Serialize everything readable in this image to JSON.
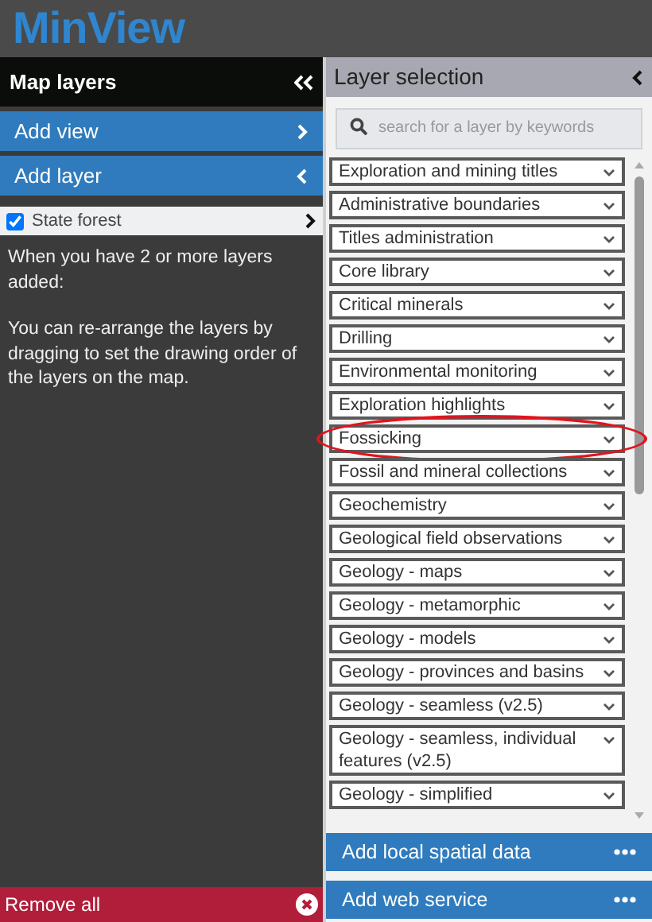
{
  "logo": "MinView",
  "map_layers": {
    "title": "Map layers",
    "actions": [
      {
        "label": "Add view",
        "expanded": false
      },
      {
        "label": "Add layer",
        "expanded": true
      }
    ],
    "layers": [
      {
        "name": "State forest",
        "checked": true
      }
    ],
    "help": [
      "When you have 2 or more layers added:",
      "You can re-arrange the layers by dragging to set the drawing order of the layers on the map."
    ],
    "remove_all": "Remove all"
  },
  "layer_selection": {
    "title": "Layer selection",
    "search": {
      "placeholder": "search for a layer by keywords"
    },
    "groups": [
      {
        "label": "Exploration and mining titles",
        "highlighted": false
      },
      {
        "label": "Administrative boundaries",
        "highlighted": false
      },
      {
        "label": "Titles administration",
        "highlighted": false
      },
      {
        "label": "Core library",
        "highlighted": false
      },
      {
        "label": "Critical minerals",
        "highlighted": false
      },
      {
        "label": "Drilling",
        "highlighted": false
      },
      {
        "label": "Environmental monitoring",
        "highlighted": false
      },
      {
        "label": "Exploration highlights",
        "highlighted": false
      },
      {
        "label": "Fossicking",
        "highlighted": true
      },
      {
        "label": "Fossil and mineral collections",
        "highlighted": false
      },
      {
        "label": "Geochemistry",
        "highlighted": false
      },
      {
        "label": "Geological field observations",
        "highlighted": false
      },
      {
        "label": "Geology - maps",
        "highlighted": false
      },
      {
        "label": "Geology - metamorphic",
        "highlighted": false
      },
      {
        "label": "Geology - models",
        "highlighted": false
      },
      {
        "label": "Geology - provinces and basins",
        "highlighted": false
      },
      {
        "label": "Geology - seamless (v2.5)",
        "highlighted": false
      },
      {
        "label": "Geology - seamless, individual features (v2.5)",
        "highlighted": false
      },
      {
        "label": "Geology - simplified",
        "highlighted": false
      }
    ],
    "actions": [
      "Add local spatial data",
      "Add web service"
    ]
  }
}
